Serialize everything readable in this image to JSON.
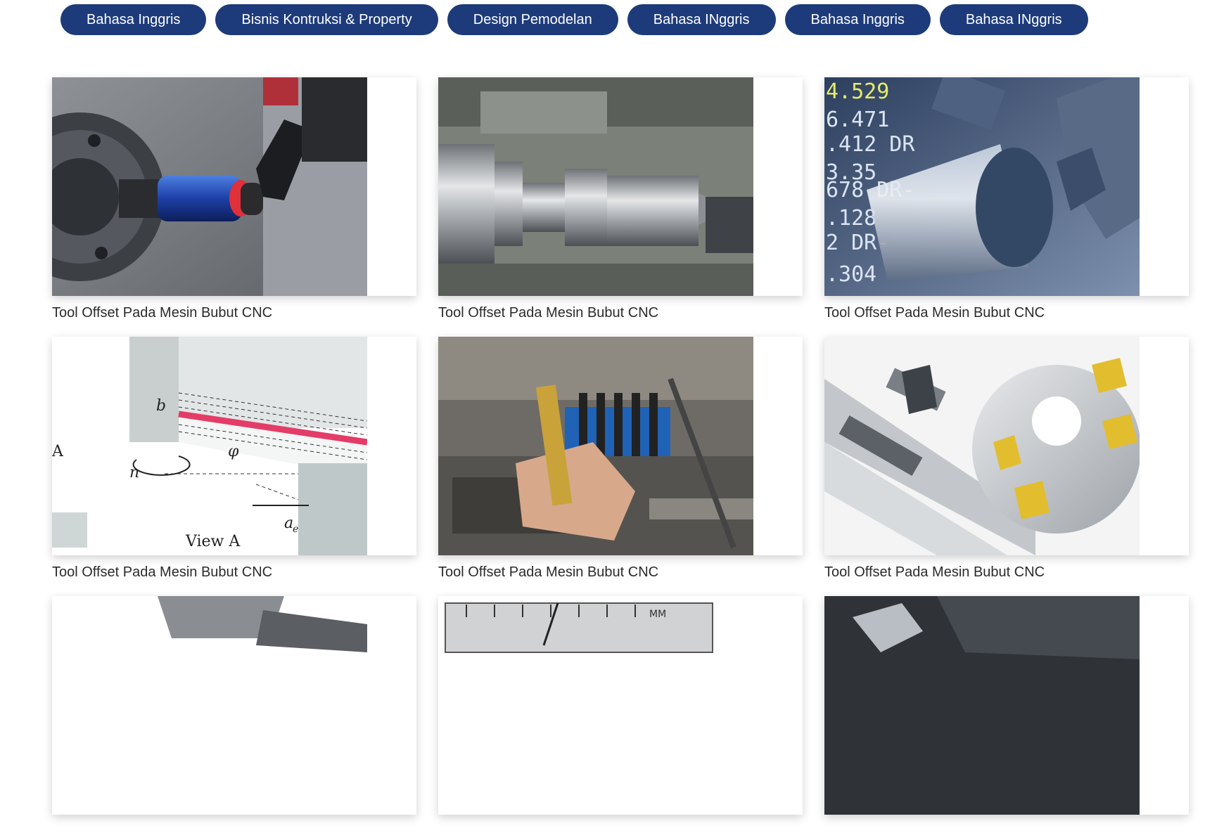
{
  "tabs": [
    "Bahasa Inggris",
    "Bisnis Kontruksi & Property",
    "Design Pemodelan",
    "Bahasa INggris",
    "Bahasa Inggris",
    "Bahasa INggris"
  ],
  "cards": [
    {
      "caption": "Tool Offset Pada Mesin Bubut CNC",
      "image": "cnc-tool-probe-image"
    },
    {
      "caption": "Tool Offset Pada Mesin Bubut CNC",
      "image": "lathe-turned-part-image"
    },
    {
      "caption": "Tool Offset Pada Mesin Bubut CNC",
      "image": "cnc-readout-cylinder-image",
      "overlay_text": [
        "4.529",
        "6.471",
        ".412 DR",
        "3.35",
        "678 DR-",
        ".128",
        "2 DR-",
        ".304"
      ]
    },
    {
      "caption": "Tool Offset Pada Mesin Bubut CNC",
      "image": "cutting-diagram-image",
      "overlay_text": [
        "b",
        "A",
        "n",
        "φ",
        "a",
        "e",
        "View A"
      ]
    },
    {
      "caption": "Tool Offset Pada Mesin Bubut CNC",
      "image": "milling-machine-hand-image"
    },
    {
      "caption": "Tool Offset Pada Mesin Bubut CNC",
      "image": "milling-cutters-image"
    },
    {
      "caption": "",
      "image": "partial-tool-image"
    },
    {
      "caption": "",
      "image": "partial-gauge-image",
      "overlay_text": [
        "MM"
      ]
    },
    {
      "caption": "",
      "image": "partial-cutter-image"
    }
  ],
  "colors": {
    "tab_bg": "#1d3b7a",
    "tab_text": "#ffffff",
    "caption_text": "#2b2b2b"
  }
}
